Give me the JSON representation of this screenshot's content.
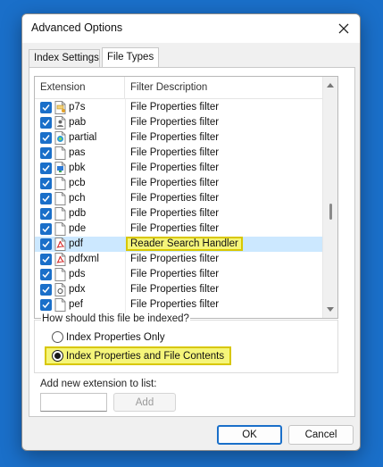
{
  "dialog": {
    "title": "Advanced Options",
    "close_icon": "close-icon"
  },
  "tabs": [
    {
      "label": "Index Settings",
      "selected": false
    },
    {
      "label": "File Types",
      "selected": true
    }
  ],
  "list": {
    "headers": {
      "extension": "Extension",
      "filter": "Filter Description"
    },
    "rows": [
      {
        "ext": "p7s",
        "filter": "File Properties filter",
        "checked": true,
        "icon": "certificate-file-icon"
      },
      {
        "ext": "pab",
        "filter": "File Properties filter",
        "checked": true,
        "icon": "contact-file-icon"
      },
      {
        "ext": "partial",
        "filter": "File Properties filter",
        "checked": true,
        "icon": "edge-partial-file-icon"
      },
      {
        "ext": "pas",
        "filter": "File Properties filter",
        "checked": true,
        "icon": "file-icon"
      },
      {
        "ext": "pbk",
        "filter": "File Properties filter",
        "checked": true,
        "icon": "network-phonebook-icon"
      },
      {
        "ext": "pcb",
        "filter": "File Properties filter",
        "checked": true,
        "icon": "file-icon"
      },
      {
        "ext": "pch",
        "filter": "File Properties filter",
        "checked": true,
        "icon": "file-icon"
      },
      {
        "ext": "pdb",
        "filter": "File Properties filter",
        "checked": true,
        "icon": "file-icon"
      },
      {
        "ext": "pde",
        "filter": "File Properties filter",
        "checked": true,
        "icon": "file-icon"
      },
      {
        "ext": "pdf",
        "filter": "Reader Search Handler",
        "checked": true,
        "icon": "pdf-file-icon",
        "selected": true
      },
      {
        "ext": "pdfxml",
        "filter": "File Properties filter",
        "checked": true,
        "icon": "pdf-file-icon"
      },
      {
        "ext": "pds",
        "filter": "File Properties filter",
        "checked": true,
        "icon": "file-icon"
      },
      {
        "ext": "pdx",
        "filter": "File Properties filter",
        "checked": true,
        "icon": "acrobat-index-file-icon"
      },
      {
        "ext": "pef",
        "filter": "File Properties filter",
        "checked": true,
        "icon": "file-icon"
      }
    ]
  },
  "indexing": {
    "question": "How should this file be indexed?",
    "options": [
      {
        "label": "Index Properties Only",
        "selected": false
      },
      {
        "label": "Index Properties and File Contents",
        "selected": true
      }
    ]
  },
  "add_extension": {
    "label": "Add new extension to list:",
    "value": "",
    "button": "Add"
  },
  "buttons": {
    "ok": "OK",
    "cancel": "Cancel"
  },
  "colors": {
    "accent": "#1a6fc9",
    "highlight": "#f5f57a",
    "selection": "#cce8ff"
  }
}
